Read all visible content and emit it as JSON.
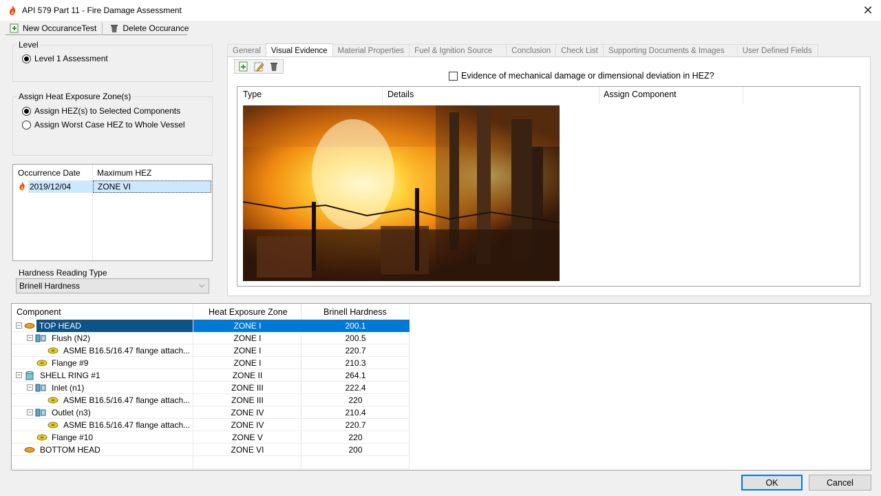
{
  "window": {
    "title": "API 579 Part 11 - Fire Damage Assessment",
    "close_glyph": "✕"
  },
  "toolbar": {
    "new_label": "New OccuranceTest",
    "delete_label": "Delete Occurance"
  },
  "level": {
    "group_label": "Level",
    "option": "Level 1 Assessment"
  },
  "hez": {
    "group_label": "Assign Heat Exposure Zone(s)",
    "option1": "Assign HEZ(s) to Selected Components",
    "option2": "Assign Worst Case HEZ to Whole Vessel"
  },
  "occurrences": {
    "col_date": "Occurrence Date",
    "col_hez": "Maximum HEZ",
    "rows": [
      {
        "date": "2019/12/04",
        "hez": "ZONE VI"
      }
    ]
  },
  "hardness": {
    "group_label": "Hardness Reading Type",
    "selected": "Brinell Hardness"
  },
  "tabs": [
    {
      "label": "General"
    },
    {
      "label": "Visual Evidence"
    },
    {
      "label": "Material Properties"
    },
    {
      "label": "Fuel & Ignition Source"
    },
    {
      "label": "Conclusion"
    },
    {
      "label": "Check List"
    },
    {
      "label": "Supporting Documents & Images"
    },
    {
      "label": "User Defined Fields"
    }
  ],
  "visual_evidence": {
    "checkbox_label": "Evidence of mechanical damage or dimensional deviation in HEZ?",
    "col_type": "Type",
    "col_details": "Details",
    "col_assign": "Assign Component"
  },
  "components": {
    "col_component": "Component",
    "col_zone": "Heat Exposure Zone",
    "col_hardness": "Brinell Hardness",
    "rows": [
      {
        "name": "TOP HEAD",
        "zone": "ZONE I",
        "hardness": "200.1"
      },
      {
        "name": "Flush (N2)",
        "zone": "ZONE I",
        "hardness": "200.5"
      },
      {
        "name": "ASME B16.5/16.47 flange attach...",
        "zone": "ZONE I",
        "hardness": "220.7"
      },
      {
        "name": "Flange #9",
        "zone": "ZONE I",
        "hardness": "210.3"
      },
      {
        "name": "SHELL RING #1",
        "zone": "ZONE II",
        "hardness": "264.1"
      },
      {
        "name": "Inlet (n1)",
        "zone": "ZONE III",
        "hardness": "222.4"
      },
      {
        "name": "ASME B16.5/16.47 flange attach...",
        "zone": "ZONE III",
        "hardness": "220"
      },
      {
        "name": "Outlet (n3)",
        "zone": "ZONE IV",
        "hardness": "210.4"
      },
      {
        "name": "ASME B16.5/16.47 flange attach...",
        "zone": "ZONE IV",
        "hardness": "220.7"
      },
      {
        "name": "Flange #10",
        "zone": "ZONE V",
        "hardness": "220"
      },
      {
        "name": "BOTTOM HEAD",
        "zone": "ZONE VI",
        "hardness": "200"
      }
    ]
  },
  "buttons": {
    "ok": "OK",
    "cancel": "Cancel"
  }
}
